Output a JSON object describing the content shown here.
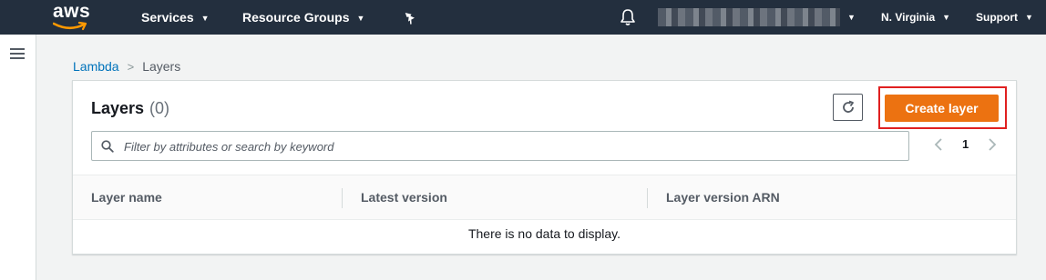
{
  "topnav": {
    "logo_text": "aws",
    "services_label": "Services",
    "resource_groups_label": "Resource Groups",
    "region_label": "N. Virginia",
    "support_label": "Support",
    "icons": {
      "pin": "pin-icon",
      "bell": "bell-icon",
      "chevron": "chevron-down-icon"
    },
    "background_color": "#232f3e",
    "smile_color": "#ff9900"
  },
  "breadcrumb": {
    "parent": "Lambda",
    "current": "Layers"
  },
  "panel": {
    "title": "Layers",
    "count": "(0)",
    "create_label": "Create layer",
    "create_color": "#ec7211",
    "highlight_color": "#e02020",
    "search_placeholder": "Filter by attributes or search by keyword",
    "page_number": "1"
  },
  "table": {
    "columns": [
      "Layer name",
      "Latest version",
      "Layer version ARN"
    ],
    "empty_message": "There is no data to display."
  }
}
